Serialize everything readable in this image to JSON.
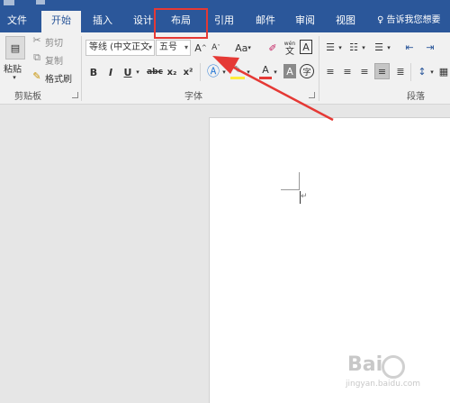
{
  "tabs": [
    {
      "label": "文件",
      "active": false
    },
    {
      "label": "开始",
      "active": true
    },
    {
      "label": "插入",
      "active": false
    },
    {
      "label": "设计",
      "active": false
    },
    {
      "label": "布局",
      "active": false
    },
    {
      "label": "引用",
      "active": false
    },
    {
      "label": "邮件",
      "active": false
    },
    {
      "label": "审阅",
      "active": false
    },
    {
      "label": "视图",
      "active": false
    }
  ],
  "tell_me": "告诉我您想要",
  "clipboard": {
    "paste": "粘贴",
    "cut": "剪切",
    "copy": "复制",
    "format_painter": "格式刷",
    "group_label": "剪贴板"
  },
  "font": {
    "font_name": "等线 (中文正文",
    "font_size": "五号",
    "group_label": "字体",
    "bold": "B",
    "italic": "I",
    "underline": "U",
    "strike": "abc",
    "subscript": "x₂",
    "superscript": "x²",
    "grow": "A",
    "change_case": "Aa",
    "phonetic": "wén",
    "phonetic_char": "文",
    "border_char": "A",
    "font_color": "A",
    "char_shading": "A",
    "enclose": "字"
  },
  "paragraph": {
    "group_label": "段落"
  },
  "colors": {
    "accent": "#2b579a",
    "highlight": "#e53935"
  },
  "watermark": {
    "text": "Bai",
    "sub": "jingyan.baidu.com"
  }
}
